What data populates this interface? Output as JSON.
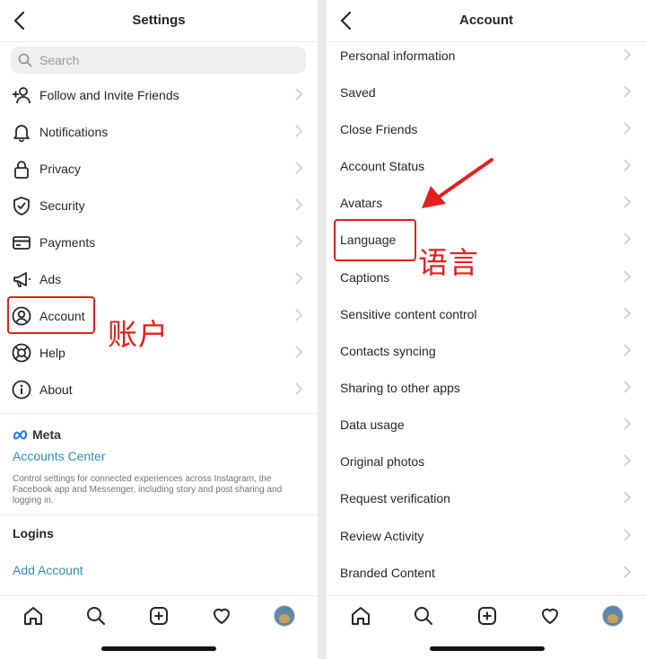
{
  "left": {
    "title": "Settings",
    "search_placeholder": "Search",
    "items": [
      {
        "label": "Follow and Invite Friends",
        "icon": "add-person-icon"
      },
      {
        "label": "Notifications",
        "icon": "bell-icon"
      },
      {
        "label": "Privacy",
        "icon": "lock-icon"
      },
      {
        "label": "Security",
        "icon": "shield-icon"
      },
      {
        "label": "Payments",
        "icon": "card-icon"
      },
      {
        "label": "Ads",
        "icon": "megaphone-icon"
      },
      {
        "label": "Account",
        "icon": "account-circle-icon"
      },
      {
        "label": "Help",
        "icon": "lifebuoy-icon"
      },
      {
        "label": "About",
        "icon": "info-icon"
      }
    ],
    "meta_brand": "Meta",
    "accounts_center": "Accounts Center",
    "meta_desc": "Control settings for connected experiences across Instagram, the Facebook app and Messenger, including story and post sharing and logging in.",
    "logins_heading": "Logins",
    "add_account": "Add Account",
    "annotation": "账户"
  },
  "right": {
    "title": "Account",
    "items": [
      "Personal information",
      "Saved",
      "Close Friends",
      "Account Status",
      "Avatars",
      "Language",
      "Captions",
      "Sensitive content control",
      "Contacts syncing",
      "Sharing to other apps",
      "Data usage",
      "Original photos",
      "Request verification",
      "Review Activity",
      "Branded Content"
    ],
    "annotation": "语言"
  },
  "tabbar": [
    "home-icon",
    "search-icon",
    "create-icon",
    "heart-icon",
    "profile-avatar"
  ],
  "colors": {
    "highlight": "#e0211c",
    "link": "#2f8fb5",
    "divider": "#e9e9ea"
  }
}
